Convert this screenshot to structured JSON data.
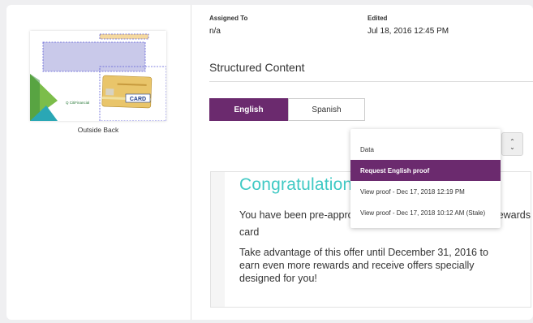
{
  "thumbnail": {
    "caption": "Outside Back",
    "brand_text": "Q CitiFinancial",
    "card_text": "CARD"
  },
  "meta": {
    "assigned_label": "Assigned To",
    "assigned_value": "n/a",
    "edited_label": "Edited",
    "edited_value": "Jul 18, 2016 12:45 PM"
  },
  "section": {
    "title": "Structured Content"
  },
  "tabs": [
    {
      "label": "English"
    },
    {
      "label": "Spanish"
    }
  ],
  "menu": {
    "items": [
      {
        "label": "Data"
      },
      {
        "label": "Request English proof"
      },
      {
        "label": "View proof - Dec 17, 2018 12:19 PM"
      },
      {
        "label": "View proof - Dec 17, 2018 10:12 AM  (Stale)"
      }
    ]
  },
  "stepper": {
    "up": "⌃",
    "down": "⌄"
  },
  "preview": {
    "heading": "Congratulations!",
    "line1": "You have been pre-approved fo",
    "line1_tail": "ewards",
    "line1b": "card",
    "paragraph": "Take advantage of this offer until December 31, 2016 to earn even more rewards and receive offers specially designed for you!"
  },
  "colors": {
    "accent": "#6b2a6e",
    "heading": "#3fc9c4"
  }
}
